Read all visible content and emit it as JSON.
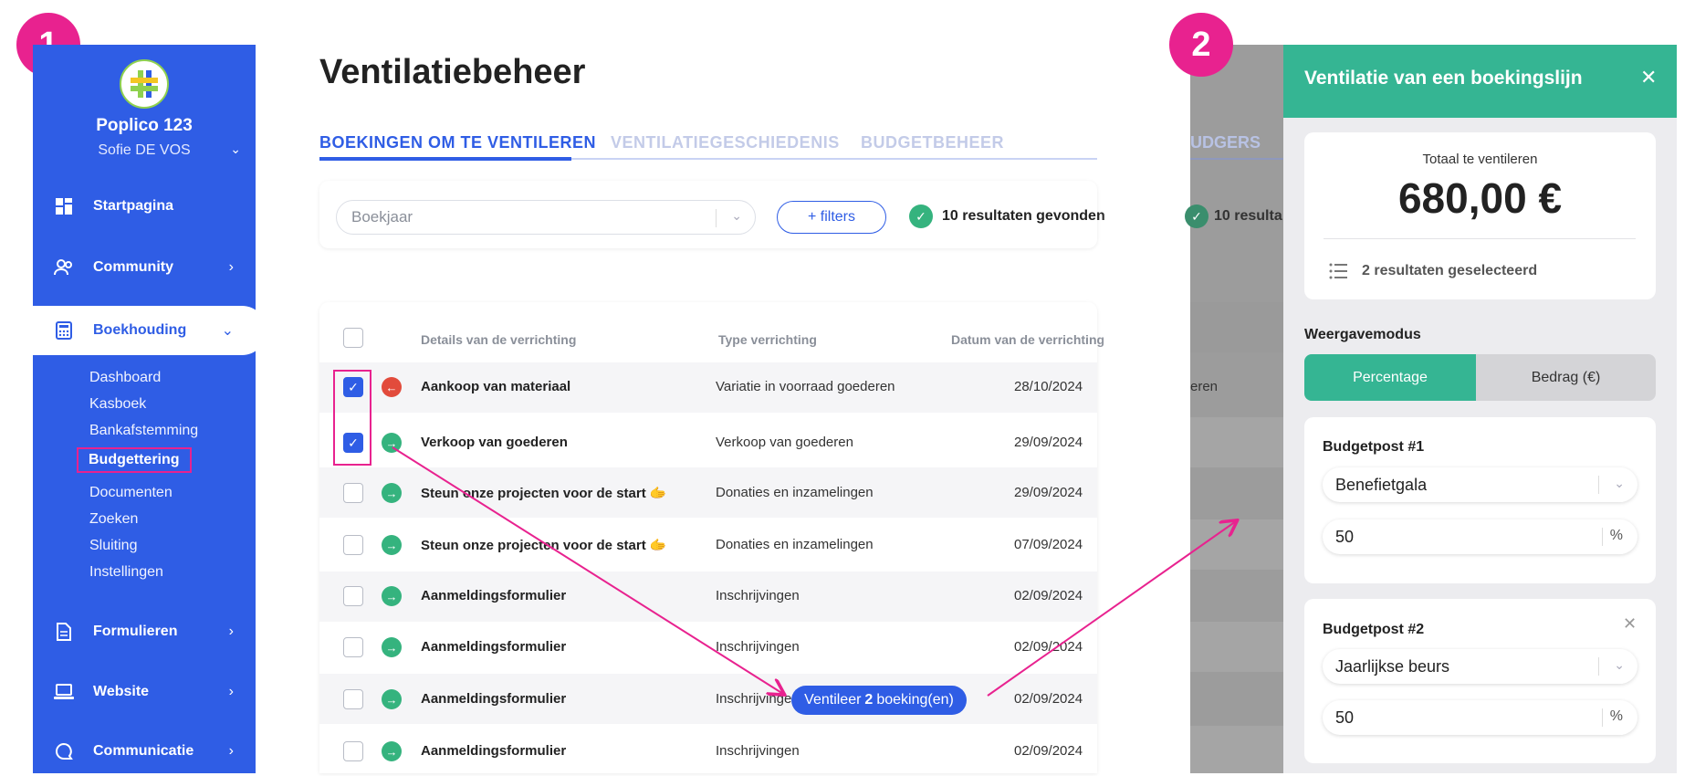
{
  "badges": {
    "one": "1",
    "two": "2"
  },
  "sidebar": {
    "org_name": "Poplico 123",
    "user_name": "Sofie DE VOS",
    "items": [
      {
        "label": "Startpagina",
        "icon": "dashboard-icon"
      },
      {
        "label": "Community",
        "icon": "people-icon"
      },
      {
        "label": "Boekhouding",
        "icon": "calculator-icon"
      },
      {
        "label": "Formulieren",
        "icon": "form-icon"
      },
      {
        "label": "Website",
        "icon": "laptop-icon"
      },
      {
        "label": "Communicatie",
        "icon": "chat-icon"
      }
    ],
    "sub_items": [
      "Dashboard",
      "Kasboek",
      "Bankafstemming",
      "Budgettering",
      "Documenten",
      "Zoeken",
      "Sluiting",
      "Instellingen"
    ]
  },
  "main": {
    "title": "Ventilatiebeheer",
    "tabs": [
      "BOEKINGEN OM TE VENTILEREN",
      "VENTILATIEGESCHIEDENIS",
      "BUDGETBEHEER"
    ],
    "select_placeholder": "Boekjaar",
    "filters_label": "+ filters",
    "results_text": "10 resultaten gevonden",
    "columns": [
      "Details van de verrichting",
      "Type verrichting",
      "Datum van de verrichting"
    ],
    "rows": [
      {
        "checked": true,
        "direction": "out",
        "detail": "Aankoop van materiaal",
        "type": "Variatie in voorraad goederen",
        "date": "28/10/2024"
      },
      {
        "checked": true,
        "direction": "in",
        "detail": "Verkoop van goederen",
        "type": "Verkoop van goederen",
        "date": "29/09/2024"
      },
      {
        "checked": false,
        "direction": "in",
        "detail": "Steun onze projecten voor de start 🫱",
        "type": "Donaties en inzamelingen",
        "date": "29/09/2024"
      },
      {
        "checked": false,
        "direction": "in",
        "detail": "Steun onze projecten voor de start 🫱",
        "type": "Donaties en inzamelingen",
        "date": "07/09/2024"
      },
      {
        "checked": false,
        "direction": "in",
        "detail": "Aanmeldingsformulier",
        "type": "Inschrijvingen",
        "date": "02/09/2024"
      },
      {
        "checked": false,
        "direction": "in",
        "detail": "Aanmeldingsformulier",
        "type": "Inschrijvingen",
        "date": "02/09/2024"
      },
      {
        "checked": false,
        "direction": "in",
        "detail": "Aanmeldingsformulier",
        "type": "Inschrijvingen",
        "date": "02/09/2024"
      },
      {
        "checked": false,
        "direction": "in",
        "detail": "Aanmeldingsformulier",
        "type": "Inschrijvingen",
        "date": "02/09/2024"
      }
    ],
    "ventileer": {
      "prefix": "Ventileer",
      "count": "2",
      "suffix": "boeking(en)"
    }
  },
  "overlay": {
    "tab_fragment": "UDGERS",
    "results_fragment": "10 resulta",
    "row_fragment": "eren"
  },
  "panel": {
    "title": "Ventilatie van een boekingslijn",
    "close": "✕",
    "total_label": "Totaal te ventileren",
    "total_value": "680,00 €",
    "selected_text": "2 resultaten geselecteerd",
    "mode_label": "Weergavemodus",
    "mode_percentage": "Percentage",
    "mode_amount": "Bedrag (€)",
    "budget_posts": [
      {
        "label": "Budgetpost #1",
        "post": "Benefietgala",
        "value": "50",
        "unit": "%"
      },
      {
        "label": "Budgetpost #2",
        "post": "Jaarlijkse beurs",
        "value": "50",
        "unit": "%"
      }
    ],
    "remove": "✕"
  },
  "colors": {
    "primary": "#2f5de5",
    "accent_pink": "#e8228f",
    "green": "#35b593",
    "red": "#e24b3c"
  }
}
